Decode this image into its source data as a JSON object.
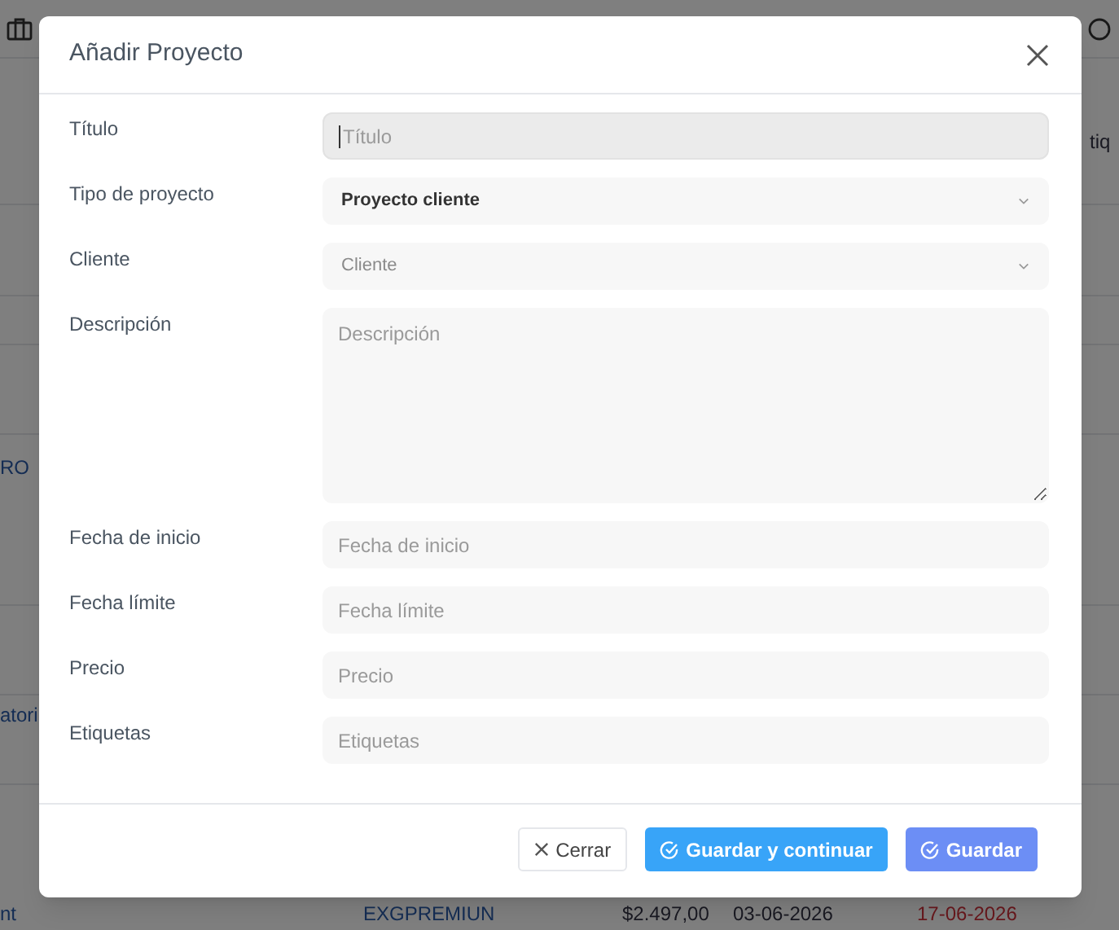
{
  "background": {
    "texts": [
      {
        "kind": "plain",
        "text": "tiq"
      },
      {
        "kind": "link",
        "text": "RO"
      },
      {
        "kind": "link",
        "text": "atori"
      },
      {
        "kind": "link",
        "text": "nt"
      },
      {
        "kind": "link",
        "text": "EXGPREMIUN"
      },
      {
        "kind": "plain",
        "text": "$2.497,00"
      },
      {
        "kind": "plain",
        "text": "03-06-2026"
      },
      {
        "kind": "overdue",
        "text": "17-06-2026"
      }
    ]
  },
  "dialog": {
    "title": "Añadir Proyecto",
    "fields": [
      {
        "label": "Título",
        "kind": "input",
        "placeholder": "Título",
        "focused": true
      },
      {
        "label": "Tipo de proyecto",
        "kind": "select",
        "value": "Proyecto cliente",
        "focused": false
      },
      {
        "label": "Cliente",
        "kind": "select",
        "placeholder": "Cliente",
        "focused": false
      },
      {
        "label": "Descripción",
        "kind": "textarea",
        "placeholder": "Descripción",
        "focused": false
      },
      {
        "label": "Fecha de inicio",
        "kind": "input",
        "placeholder": "Fecha de inicio",
        "focused": false
      },
      {
        "label": "Fecha límite",
        "kind": "input",
        "placeholder": "Fecha límite",
        "focused": false
      },
      {
        "label": "Precio",
        "kind": "input",
        "placeholder": "Precio",
        "focused": false
      },
      {
        "label": "Etiquetas",
        "kind": "input",
        "placeholder": "Etiquetas",
        "focused": false
      }
    ],
    "buttons": [
      {
        "label": "Cerrar",
        "kind": "close"
      },
      {
        "label": "Guardar y continuar",
        "kind": "save-continue"
      },
      {
        "label": "Guardar",
        "kind": "save"
      }
    ]
  }
}
